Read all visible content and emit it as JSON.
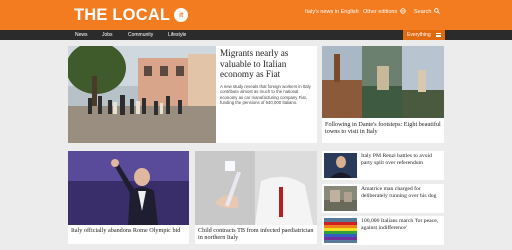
{
  "header": {
    "logo_text": "THE LOCAL",
    "logo_badge": "it",
    "italy_news_label": "Italy's news in English",
    "other_editions_label": "Other editions",
    "search_label": "Search"
  },
  "nav": {
    "items": [
      "News",
      "Jobs",
      "Community",
      "Lifestyle"
    ],
    "everything_label": "Everything"
  },
  "articles": {
    "feature": {
      "title": "Migrants nearly as valuable to Italian economy as Fiat",
      "summary": "A new study reveals that foreign workers in Italy contribute almost as much to the national economy as car manufacturing company Fiat, funding the pensions of 640,000 Italians."
    },
    "dante": {
      "title": "Following in Dante's footsteps: Eight beautiful towns to visit in Italy"
    },
    "olympic": {
      "title": "Italy officially abandons Rome Olympic bid"
    },
    "tb": {
      "title": "Child contracts TB from infected paediatrician in northern Italy"
    },
    "renzi": {
      "title": "Italy PM Renzi battles to avoid party split over referendum"
    },
    "amatrice": {
      "title": "Amatrice man charged for deliberately running over his dog"
    },
    "peace": {
      "title": "100,000 Italians march 'for peace, against indifference'"
    }
  },
  "colors": {
    "brand": "#f47c20",
    "nav_bg": "#2b2b2b",
    "everything_bg": "#e06a10"
  }
}
